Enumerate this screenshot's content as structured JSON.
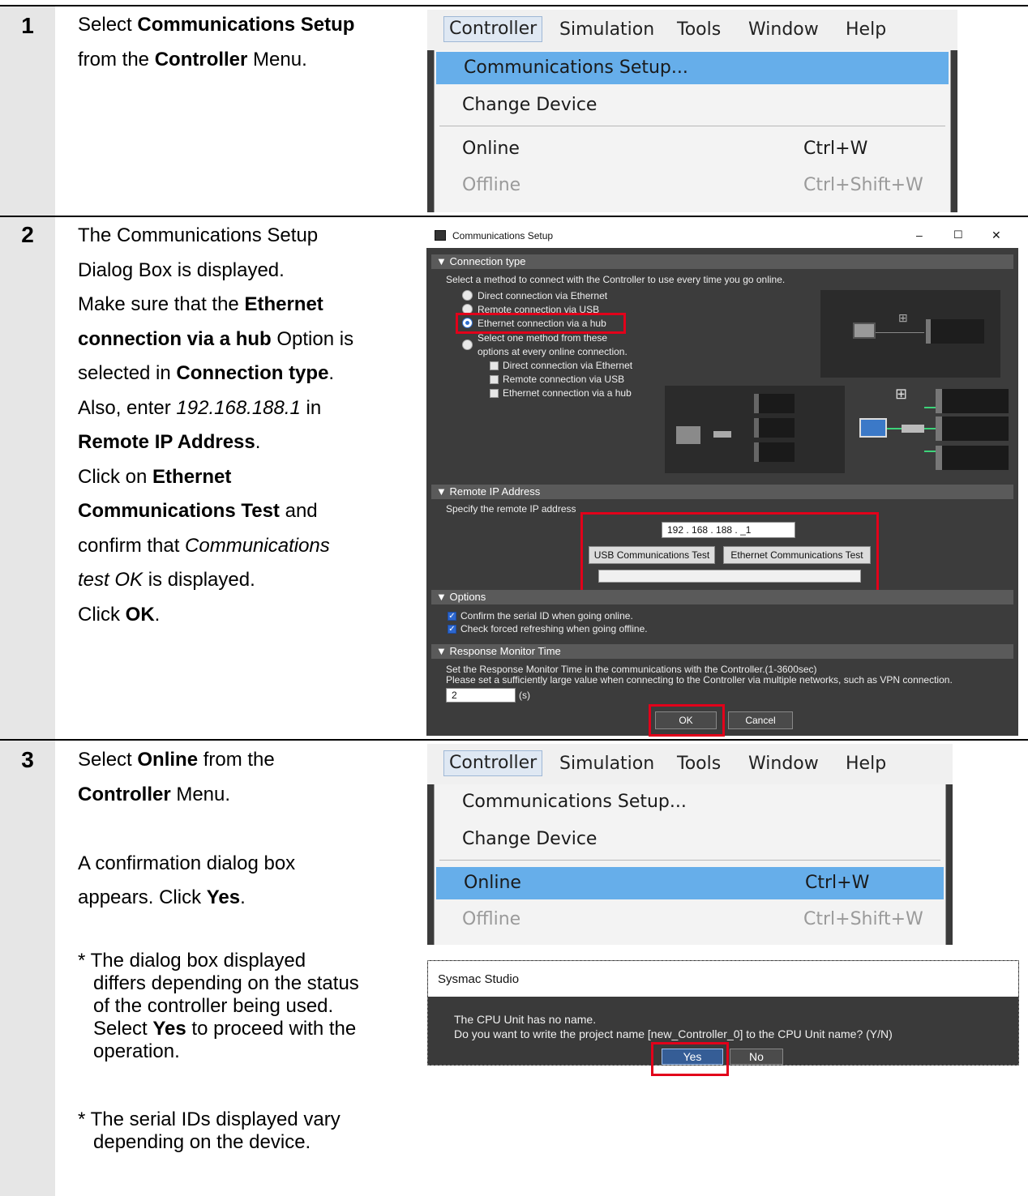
{
  "steps": [
    {
      "num": "1",
      "lines": [
        {
          "pre": "Select ",
          "bold": "Communications Setup",
          "post": ""
        },
        {
          "pre": "from the ",
          "bold": "Controller",
          "post": " Menu."
        }
      ]
    },
    {
      "num": "2",
      "lines": [
        {
          "pre": "The Communications Setup",
          "bold": "",
          "post": ""
        },
        {
          "pre": "Dialog Box is displayed.",
          "bold": "",
          "post": ""
        },
        {
          "pre": "Make sure that the ",
          "bold": "Ethernet",
          "post": ""
        },
        {
          "pre": "",
          "bold": "connection via a hub",
          "post": " Option is"
        },
        {
          "pre": "selected in ",
          "bold": "Connection type",
          "post": "."
        },
        {
          "pre": "Also, enter ",
          "ital": "192.168.188.1",
          "post": " in"
        },
        {
          "pre": "",
          "bold": "Remote IP Address",
          "post": "."
        },
        {
          "pre": "Click on ",
          "bold": "Ethernet",
          "post": ""
        },
        {
          "pre": "",
          "bold": "Communications Test",
          "post": " and"
        },
        {
          "pre": "confirm that ",
          "ital": "Communications",
          "post": ""
        },
        {
          "pre": "",
          "ital": "test OK",
          "post": " is displayed."
        },
        {
          "pre": "Click ",
          "bold": "OK",
          "post": "."
        }
      ]
    },
    {
      "num": "3",
      "lines": [
        {
          "pre": "Select ",
          "bold": "Online",
          "post": " from the"
        },
        {
          "pre": "",
          "bold": "Controller",
          "post": " Menu."
        },
        {
          "pre": "",
          "bold": "",
          "post": ""
        },
        {
          "pre": "A confirmation dialog box",
          "bold": "",
          "post": ""
        },
        {
          "pre": "appears. Click ",
          "bold": "Yes",
          "post": "."
        }
      ],
      "note1": {
        "l1": "* The dialog box displayed",
        "l2": "differs depending on the status",
        "l3": "of the controller being used.",
        "l4_pre": "Select ",
        "l4_bold": "Yes",
        "l4_post": " to proceed with the",
        "l5": "operation."
      },
      "note2": {
        "l1": "* The serial IDs displayed vary",
        "l2": "depending on the device."
      }
    }
  ],
  "menu": {
    "bar": [
      "Controller",
      "Simulation",
      "Tools",
      "Window",
      "Help"
    ],
    "items": [
      {
        "label": "Communications Setup...",
        "shortcut": ""
      },
      {
        "label": "Change Device",
        "shortcut": ""
      },
      {
        "label": "Online",
        "shortcut": "Ctrl+W"
      },
      {
        "label": "Offline",
        "shortcut": "Ctrl+Shift+W"
      }
    ]
  },
  "dialog": {
    "title": "Communications Setup",
    "window_controls": [
      "–",
      "☐",
      "✕"
    ],
    "section_connection": "▼ Connection type",
    "connection_hint": "Select a method to connect with the Controller to use every time you go online.",
    "radios": [
      "Direct connection via Ethernet",
      "Remote connection via USB",
      "Ethernet connection via a hub"
    ],
    "radio_multi_l1": "Select one method from these",
    "radio_multi_l2": "options at every online connection.",
    "checks": [
      "Direct connection via Ethernet",
      "Remote connection via USB",
      "Ethernet connection via a hub"
    ],
    "section_ip": "▼ Remote IP Address",
    "ip_hint": "Specify the remote IP address",
    "ip_value": "192 . 168 . 188 . _1",
    "usb_test": "USB Communications Test",
    "eth_test": "Ethernet Communications Test",
    "section_options": "▼ Options",
    "opt1": "Confirm the serial ID when going online.",
    "opt2": "Check forced refreshing when going offline.",
    "section_response": "▼ Response Monitor Time",
    "resp1": "Set the Response Monitor Time in the communications with the Controller.(1-3600sec)",
    "resp2": "Please set a sufficiently large value when connecting to the Controller via multiple networks, such as VPN connection.",
    "resp_value": "2",
    "resp_unit": "(s)",
    "ok": "OK",
    "cancel": "Cancel"
  },
  "confirm": {
    "title": "Sysmac Studio",
    "line1": "The CPU Unit has no name.",
    "line2": "Do you want to write the project name [new_Controller_0] to the CPU Unit name? (Y/N)",
    "yes": "Yes",
    "no": "No"
  },
  "colors": {
    "highlight": "#66aeea",
    "red_frame": "#e2001a",
    "step_column": "#e6e6e6"
  }
}
